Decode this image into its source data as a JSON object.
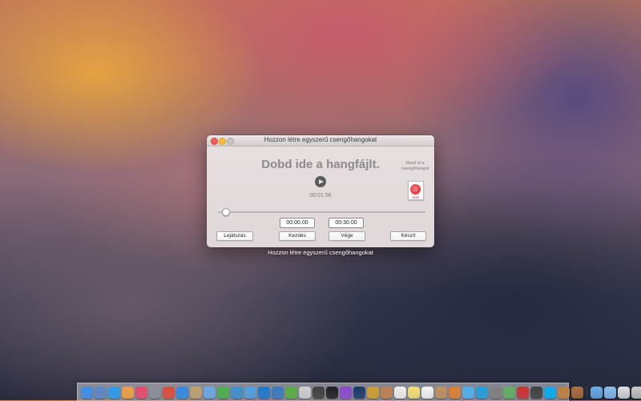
{
  "window": {
    "title": "Hozzon létre egyszerű csengőhangokat",
    "drop_text": "Dobd ide a hangfájlt.",
    "drag_hint": "Húzd el a csengőhangot",
    "file_icon": {
      "icon": "music-file-icon",
      "ext": "M4R"
    },
    "time_display": "00:01.56",
    "start_time": "00:00.00",
    "end_time": "00:30.00",
    "position_fraction": 0.02,
    "buttons": {
      "play": "Lejátszás",
      "set_start": "Kezdés",
      "set_end": "Vége",
      "create": "Készít"
    }
  },
  "window_caption": "Hozzon létre egyszerű csengőhangokat",
  "dock": {
    "apps": [
      {
        "name": "finder",
        "color": "#3d8ee8"
      },
      {
        "name": "preview",
        "color": "#5a88c8"
      },
      {
        "name": "app-store",
        "color": "#2b9bf0"
      },
      {
        "name": "photos",
        "color": "#f0a040"
      },
      {
        "name": "itunes",
        "color": "#e84a6a"
      },
      {
        "name": "launchpad",
        "color": "#8a8f9a"
      },
      {
        "name": "chrome",
        "color": "#e04a3a"
      },
      {
        "name": "safari",
        "color": "#2f8ae8"
      },
      {
        "name": "book",
        "color": "#c0a070"
      },
      {
        "name": "mail",
        "color": "#6aa8e8"
      },
      {
        "name": "facetime",
        "color": "#4ab04a"
      },
      {
        "name": "sharing",
        "color": "#3a90d0"
      },
      {
        "name": "finder-2",
        "color": "#50a0e0"
      },
      {
        "name": "mail-2",
        "color": "#1a7ad0"
      },
      {
        "name": "xcode",
        "color": "#3a7ac0"
      },
      {
        "name": "leaf",
        "color": "#5ab040"
      },
      {
        "name": "mirror",
        "color": "#d0d0d0"
      },
      {
        "name": "activity",
        "color": "#404040"
      },
      {
        "name": "terminal",
        "color": "#202020"
      },
      {
        "name": "podcasts",
        "color": "#8a4ad0"
      },
      {
        "name": "photoshop",
        "color": "#1a3a6a"
      },
      {
        "name": "keychain",
        "color": "#d0a030"
      },
      {
        "name": "notes",
        "color": "#c08050"
      },
      {
        "name": "calendar",
        "color": "#f0f0f0"
      },
      {
        "name": "notes-2",
        "color": "#f5e070"
      },
      {
        "name": "reminders",
        "color": "#f5f5f5"
      },
      {
        "name": "contacts",
        "color": "#c09060"
      },
      {
        "name": "color-picker",
        "color": "#e08030"
      },
      {
        "name": "messages",
        "color": "#50b0f0"
      },
      {
        "name": "skype",
        "color": "#20a0e0"
      },
      {
        "name": "clock",
        "color": "#808080"
      },
      {
        "name": "maps",
        "color": "#60b060"
      },
      {
        "name": "pdf",
        "color": "#d03030"
      },
      {
        "name": "iphone",
        "color": "#404040"
      },
      {
        "name": "skype-2",
        "color": "#00aff0"
      },
      {
        "name": "magnifier",
        "color": "#c08040"
      },
      {
        "name": "preview-2",
        "color": "#b07040"
      }
    ],
    "trailing": [
      {
        "name": "folder",
        "color": "#6aaee8"
      },
      {
        "name": "folder-2",
        "color": "#8ac0f0"
      },
      {
        "name": "keyboard",
        "color": "#e0e0e0"
      },
      {
        "name": "trash",
        "color": "#c8c8c8"
      }
    ]
  }
}
